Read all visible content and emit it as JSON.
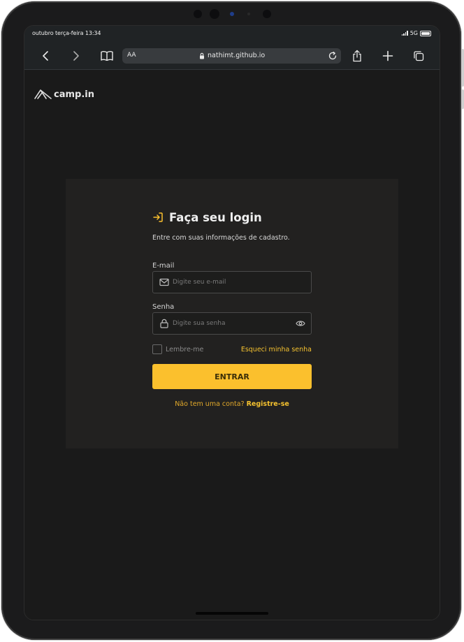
{
  "status": {
    "time": "outubro terça-feira 13:34",
    "network": "5G"
  },
  "browser": {
    "aa_label": "AA",
    "url": "nathimt.github.io"
  },
  "brand": {
    "name": "camp.in"
  },
  "login": {
    "title": "Faça seu login",
    "subtitle": "Entre com suas informações de cadastro.",
    "email_label": "E-mail",
    "email_placeholder": "Digite seu e-mail",
    "password_label": "Senha",
    "password_placeholder": "Digite sua senha",
    "remember_label": "Lembre-me",
    "forgot_label": "Esqueci minha senha",
    "submit_label": "ENTRAR",
    "register_prompt": "Não tem uma conta?",
    "register_link": "Registre-se"
  },
  "colors": {
    "accent": "#fbc02d",
    "background": "#1a1a1a",
    "card": "#222120"
  }
}
